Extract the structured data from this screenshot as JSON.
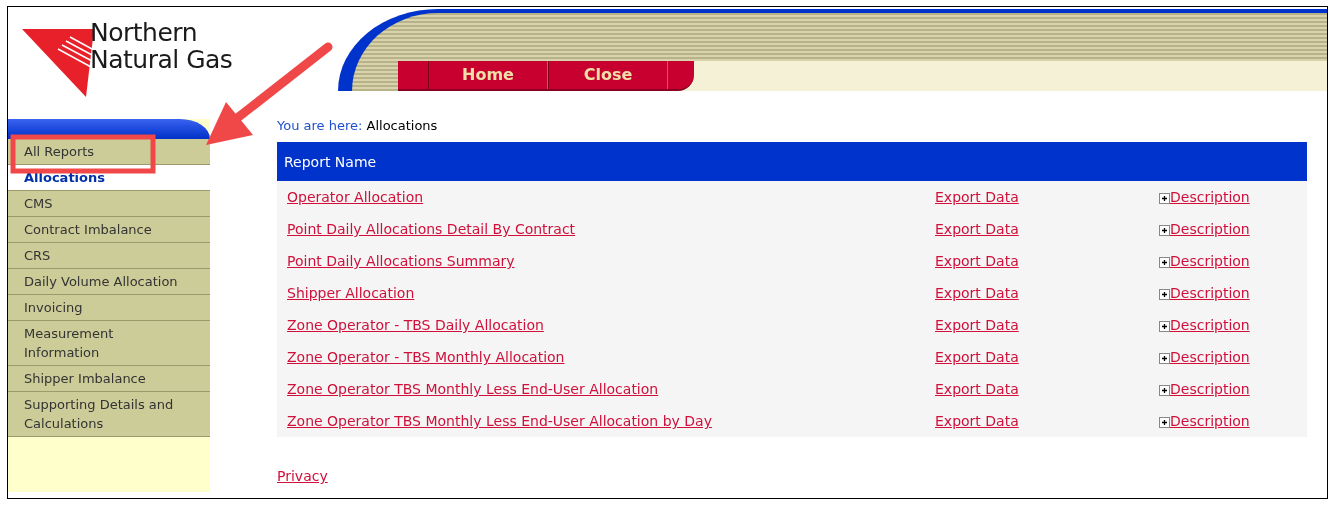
{
  "logo": {
    "lines": [
      "Northern",
      "Natural Gas"
    ]
  },
  "nav": [
    {
      "label": "Home"
    },
    {
      "label": "Close"
    }
  ],
  "sidebar": {
    "items": [
      {
        "label": "All Reports",
        "selected": false
      },
      {
        "label": "Allocations",
        "selected": true
      },
      {
        "label": "CMS",
        "selected": false
      },
      {
        "label": "Contract Imbalance",
        "selected": false
      },
      {
        "label": "CRS",
        "selected": false
      },
      {
        "label": "Daily Volume Allocation",
        "selected": false
      },
      {
        "label": "Invoicing",
        "selected": false
      },
      {
        "label": "Measurement Information",
        "selected": false
      },
      {
        "label": "Shipper Imbalance",
        "selected": false
      },
      {
        "label": "Supporting Details and Calculations",
        "selected": false
      }
    ]
  },
  "breadcrumb": {
    "label": "You are here:",
    "current": "Allocations"
  },
  "table": {
    "columns": [
      "Report Name"
    ],
    "rows": [
      {
        "name": "Operator Allocation",
        "export": "Export Data",
        "description": "Description"
      },
      {
        "name": "Point Daily Allocations Detail By Contract",
        "export": "Export Data",
        "description": "Description"
      },
      {
        "name": "Point Daily Allocations Summary",
        "export": "Export Data",
        "description": "Description"
      },
      {
        "name": "Shipper Allocation",
        "export": "Export Data",
        "description": "Description"
      },
      {
        "name": "Zone Operator - TBS Daily Allocation",
        "export": "Export Data",
        "description": "Description"
      },
      {
        "name": "Zone Operator - TBS Monthly Allocation",
        "export": "Export Data",
        "description": "Description"
      },
      {
        "name": "Zone Operator TBS Monthly Less End-User Allocation",
        "export": "Export Data",
        "description": "Description"
      },
      {
        "name": "Zone Operator TBS Monthly Less End-User Allocation by Day",
        "export": "Export Data",
        "description": "Description"
      }
    ]
  },
  "footer": {
    "link": "Privacy"
  }
}
